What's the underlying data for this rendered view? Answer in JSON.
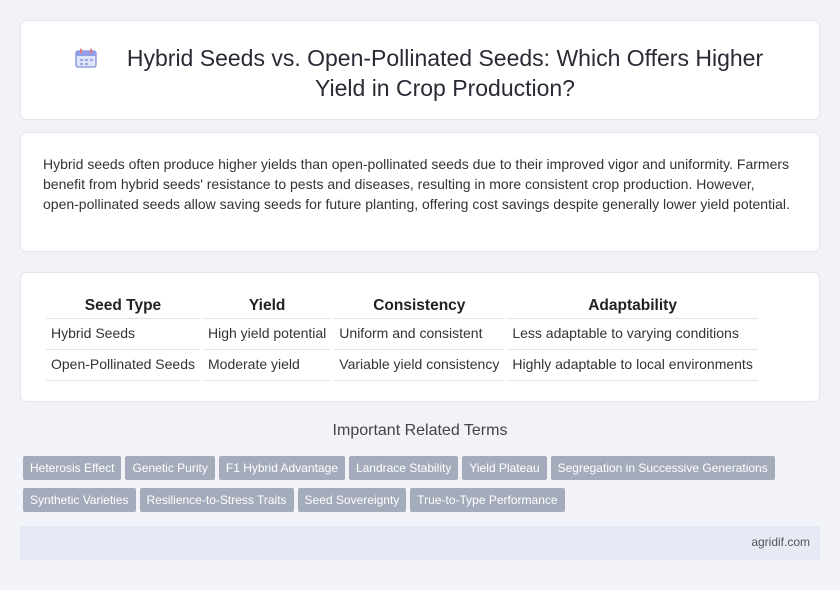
{
  "header": {
    "title": "Hybrid Seeds vs. Open-Pollinated Seeds: Which Offers Higher Yield in Crop Production?",
    "icon": "calendar-icon",
    "icon_color": "#7e8fd6"
  },
  "intro": {
    "text": "Hybrid seeds often produce higher yields than open-pollinated seeds due to their improved vigor and uniformity. Farmers benefit from hybrid seeds' resistance to pests and diseases, resulting in more consistent crop production. However, open-pollinated seeds allow saving seeds for future planting, offering cost savings despite generally lower yield potential."
  },
  "table": {
    "headers": [
      "Seed Type",
      "Yield",
      "Consistency",
      "Adaptability"
    ],
    "rows": [
      [
        "Hybrid Seeds",
        "High yield potential",
        "Uniform and consistent",
        "Less adaptable to varying conditions"
      ],
      [
        "Open-Pollinated Seeds",
        "Moderate yield",
        "Variable yield consistency",
        "Highly adaptable to local environments"
      ]
    ]
  },
  "related": {
    "heading": "Important Related Terms",
    "tags": [
      "Heterosis Effect",
      "Genetic Purity",
      "F1 Hybrid Advantage",
      "Landrace Stability",
      "Yield Plateau",
      "Segregation in Successive Generations",
      "Synthetic Varieties",
      "Resilience-to-Stress Traits",
      "Seed Sovereignty",
      "True-to-Type Performance"
    ],
    "tag_color": "#a4abba"
  },
  "footer": {
    "site": "agridif.com"
  }
}
